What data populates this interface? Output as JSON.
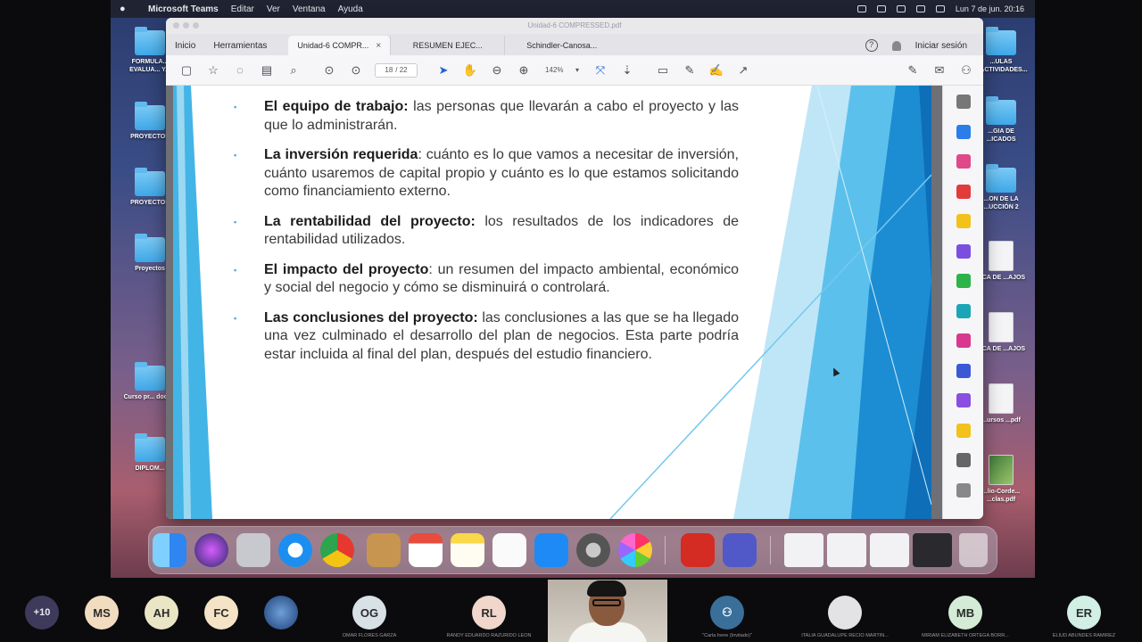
{
  "menubar": {
    "app": "Microsoft Teams",
    "items": [
      "Editar",
      "Ver",
      "Ventana",
      "Ayuda"
    ],
    "clock": "Lun 7 de jun. 20:16"
  },
  "desktop_icons": [
    {
      "label": "FORMULA... EVALUA... Y..."
    },
    {
      "label": "PROYECTOS"
    },
    {
      "label": "PROYECTOS"
    },
    {
      "label": "Proyectos"
    },
    {
      "label": "Curso pr... doce..."
    },
    {
      "label": "DIPLOM..."
    },
    {
      "label": "...ULAS ...ACTIVIDADES..."
    },
    {
      "label": "...GIA DE ...ICADOS"
    },
    {
      "label": "...ON DE LA ...UCCIÓN 2"
    },
    {
      "label": "...CA DE ...AJOS"
    },
    {
      "label": "...CA DE ...AJOS"
    },
    {
      "label": "...ursos ...pdf"
    },
    {
      "label": "...lio-Corde... ...clas.pdf"
    }
  ],
  "pdf": {
    "window_title": "Unidad-6 COMPRESSED.pdf",
    "nav_tabs": [
      "Inicio",
      "Herramientas"
    ],
    "doc_tabs": [
      {
        "label": "Unidad-6 COMPR...",
        "close": "×"
      },
      {
        "label": "RESUMEN EJEC..."
      },
      {
        "label": "Schindler-Canosa..."
      }
    ],
    "help_icon": "?",
    "signin": "Iniciar sesión",
    "page_current": "18",
    "page_total": "/ 22",
    "zoom": "142%",
    "zoom_caret": "▾",
    "bullets": [
      {
        "term": "El equipo de trabajo:",
        "text": " las personas que llevarán a cabo el proyecto y las que lo administrarán."
      },
      {
        "term": "La inversión requerida",
        "text": ": cuánto es lo que vamos a necesitar de inversión, cuánto usaremos de capital propio y cuánto es lo que estamos solicitando como financiamiento externo."
      },
      {
        "term": "La rentabilidad del proyecto:",
        "text": " los resultados de los indicadores de rentabilidad utilizados."
      },
      {
        "term": "El impacto del proyecto",
        "text": ": un resumen del impacto ambiental, económico y social del negocio y cómo se disminuirá o controlará."
      },
      {
        "term": "Las conclusiones del proyecto:",
        "text": " las conclusiones a las que se ha llegado una vez culminado el desarrollo del plan de negocios. Esta parte podría estar incluida al final del plan, después del estudio financiero."
      }
    ],
    "bullet_glyph": "▪"
  },
  "colors": {
    "accent_blue": "#1f63d6",
    "slide_blue": "#3aa6dd",
    "slide_dark": "#0e6fb8"
  },
  "participants": [
    {
      "initials": "+10",
      "name": "",
      "color": "#3d3a5c"
    },
    {
      "initials": "MS",
      "name": "",
      "color": "#f2dcc0"
    },
    {
      "initials": "AH",
      "name": "",
      "color": "#e9e5c5"
    },
    {
      "initials": "FC",
      "name": "",
      "color": "#f4e3c6"
    },
    {
      "initials": "OG",
      "name": "OMAR FLORES GARZA",
      "color": "#d8e1e6"
    },
    {
      "initials": "RL",
      "name": "RANDY EDUARDO RAZURIDO LEON",
      "color": "#f1d7cb"
    },
    {
      "initials": "",
      "name": "\"Carla Irene (Invitado)\"",
      "color": "#3a6f9a"
    },
    {
      "initials": "",
      "name": "ITALIA GUADALUPE RECIO MARTIN...",
      "color": "#e3e3e6"
    },
    {
      "initials": "MB",
      "name": "MIRIAM ELIZABETH ORTEGA BORR...",
      "color": "#d4ecd6"
    },
    {
      "initials": "ER",
      "name": "ELIUD ABUNDES RAMIREZ",
      "color": "#d2efe6"
    }
  ]
}
